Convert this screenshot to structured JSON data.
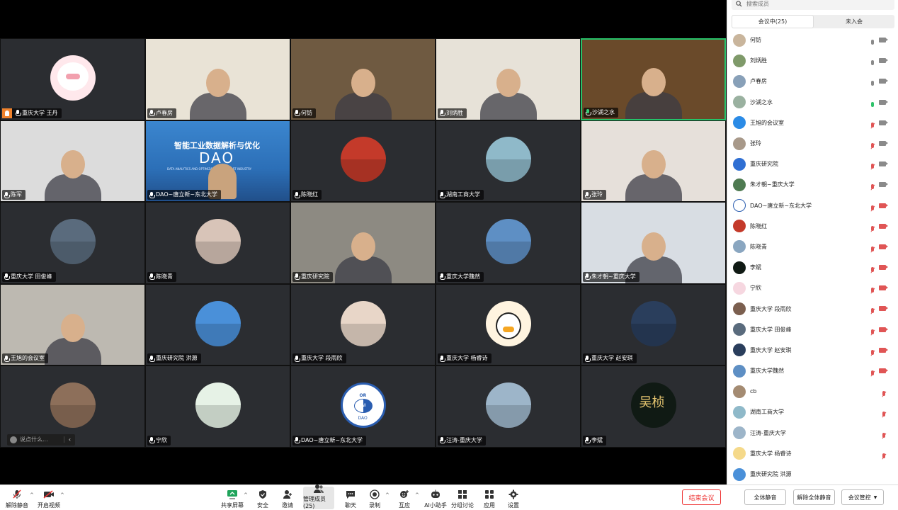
{
  "panel": {
    "search_placeholder": "搜索成员",
    "tab_in_meeting": "会议中(25)",
    "tab_not_joined": "未入会"
  },
  "tiles": [
    {
      "label": "重庆大学 王丹",
      "type": "avatar",
      "bg": "#ffe8ec"
    },
    {
      "label": "卢春房",
      "type": "video",
      "bg": "#e9e3d6"
    },
    {
      "label": "何钫",
      "type": "video",
      "bg": "#6f5a41"
    },
    {
      "label": "刘炳胜",
      "type": "video",
      "bg": "#e7e2d8"
    },
    {
      "label": "沙湖之水",
      "type": "video",
      "bg": "#6a4a2a"
    },
    {
      "label": "陈军",
      "type": "video",
      "bg": "#dcdcdc"
    },
    {
      "label": "DAO~唐立新~东北大学",
      "type": "video",
      "bg": "#2c6fb7"
    },
    {
      "label": "陈晓红",
      "type": "avatar",
      "bg": "#c43a2a"
    },
    {
      "label": "湖南工商大学",
      "type": "avatar",
      "bg": "#8fb9c9"
    },
    {
      "label": "张玲",
      "type": "video",
      "bg": "#e6e0da"
    },
    {
      "label": "重庆大学 田俊峰",
      "type": "avatar",
      "bg": "#5a6b7d"
    },
    {
      "label": "陈晓青",
      "type": "avatar",
      "bg": "#d8c4b8"
    },
    {
      "label": "重庆研究院",
      "type": "video",
      "bg": "#8d8a82"
    },
    {
      "label": "重庆大学魏然",
      "type": "avatar",
      "bg": "#5e8fc4"
    },
    {
      "label": "朱才朝~重庆大学",
      "type": "video",
      "bg": "#d8dde3"
    },
    {
      "label": "王旭的会议室",
      "type": "video",
      "bg": "#bdb9b1"
    },
    {
      "label": "重庆研究院 洪源",
      "type": "avatar",
      "bg": "#4a90d9"
    },
    {
      "label": "重庆大学 段雨欣",
      "type": "avatar",
      "bg": "#e8d6c8"
    },
    {
      "label": "重庆大学 杨睿诗",
      "type": "avatar",
      "bg": "#fff4e0"
    },
    {
      "label": "重庆大学 赵安琪",
      "type": "avatar",
      "bg": "#2a3e5c"
    },
    {
      "label": "",
      "type": "avatar",
      "bg": "#8d6f5a"
    },
    {
      "label": "宁欣",
      "type": "avatar",
      "bg": "#e6f2e6"
    },
    {
      "label": "DAO~唐立新~东北大学",
      "type": "avatar",
      "bg": "#ffffff"
    },
    {
      "label": "汪涛-重庆大学",
      "type": "avatar",
      "bg": "#9db5c9"
    },
    {
      "label": "李斌",
      "type": "avatar",
      "bg": "#101a14"
    }
  ],
  "dao_banner": {
    "title": "智能工业数据解析与优化",
    "acronym": "DAO",
    "subtitle": "DATA ANALYTICS AND OPTIMIZATION FOR SMART INDUSTRY"
  },
  "dao_logo": {
    "top": "Data Analytics and Optimization",
    "or": "OR",
    "ai": "AI",
    "dao": "DAO"
  },
  "calligraphy": "吴桢",
  "chat_placeholder": "说点什么...",
  "members": [
    {
      "name": "何钫",
      "mic": "on",
      "cam": "on",
      "av": "#c9b59c"
    },
    {
      "name": "刘炳胜",
      "mic": "on",
      "cam": "on",
      "av": "#7f9a6a"
    },
    {
      "name": "卢春房",
      "mic": "on",
      "cam": "on",
      "av": "#88a0b8"
    },
    {
      "name": "沙湖之水",
      "mic": "green",
      "cam": "on",
      "av": "#9ab1a0"
    },
    {
      "name": "王旭的会议室",
      "mic": "muted",
      "cam": "on",
      "av": "#2b8be6"
    },
    {
      "name": "张玲",
      "mic": "muted",
      "cam": "on",
      "av": "#a8998a"
    },
    {
      "name": "重庆研究院",
      "mic": "muted",
      "cam": "on",
      "av": "#2f6fd3"
    },
    {
      "name": "朱才朝~重庆大学",
      "mic": "muted",
      "cam": "on",
      "av": "#4f7b52"
    },
    {
      "name": "DAO~唐立新~东北大学",
      "mic": "muted",
      "cam": "off",
      "av": "#ffffff"
    },
    {
      "name": "陈晓红",
      "mic": "muted",
      "cam": "off",
      "av": "#c43a2a"
    },
    {
      "name": "陈晓青",
      "mic": "muted",
      "cam": "off",
      "av": "#8aa6c0"
    },
    {
      "name": "李斌",
      "mic": "muted",
      "cam": "off",
      "av": "#101a14"
    },
    {
      "name": "宁欣",
      "mic": "muted",
      "cam": "off",
      "av": "#f6d7e0"
    },
    {
      "name": "重庆大学 段雨欣",
      "mic": "muted",
      "cam": "off",
      "av": "#7b5f4f"
    },
    {
      "name": "重庆大学 田俊峰",
      "mic": "muted",
      "cam": "off",
      "av": "#5a6b7d"
    },
    {
      "name": "重庆大学 赵安琪",
      "mic": "muted",
      "cam": "off",
      "av": "#2a3e5c"
    },
    {
      "name": "重庆大学魏然",
      "mic": "muted",
      "cam": "off",
      "av": "#5e8fc4"
    },
    {
      "name": "cb",
      "mic": "muted",
      "cam": "none",
      "av": "#a48b72"
    },
    {
      "name": "湖南工商大学",
      "mic": "muted",
      "cam": "none",
      "av": "#8fb9c9"
    },
    {
      "name": "汪涛-重庆大学",
      "mic": "muted",
      "cam": "none",
      "av": "#9db5c9"
    },
    {
      "name": "重庆大学 杨睿诗",
      "mic": "muted",
      "cam": "none",
      "av": "#f5d98a"
    },
    {
      "name": "重庆研究院 洪源",
      "mic": "none",
      "cam": "none",
      "av": "#4a90d9"
    }
  ],
  "toolbar": {
    "unmute": "解除静音",
    "start_video": "开启视频",
    "share_screen": "共享屏幕",
    "security": "安全",
    "invite": "邀请",
    "manage_members": "管理成员(25)",
    "chat": "聊天",
    "record": "录制",
    "reactions": "互应",
    "ai_assistant": "AI小助手",
    "breakout": "分组讨论",
    "apps": "应用",
    "settings": "设置",
    "end_meeting": "结束会议",
    "mute_all": "全体静音",
    "unmute_all": "解除全体静音",
    "meeting_control": "会议管控"
  },
  "colors": {
    "end_red": "#e33333",
    "active_green": "#25c26a",
    "host_orange": "#f0822c"
  }
}
